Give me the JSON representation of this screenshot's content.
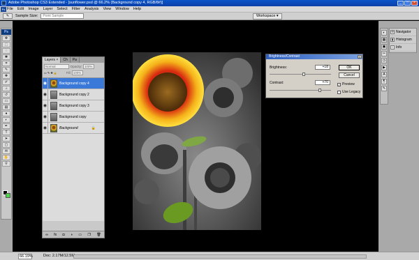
{
  "window": {
    "title": "Adobe Photoshop CS3 Extended - [sunflower.psd @ 66.2% (Background copy 4, RGB/8#)]",
    "buttons": [
      "_",
      "□",
      "×"
    ]
  },
  "menubar": {
    "items": [
      "File",
      "Edit",
      "Image",
      "Layer",
      "Select",
      "Filter",
      "Analysis",
      "View",
      "Window",
      "Help"
    ]
  },
  "options": {
    "sample_size_label": "Sample Size:",
    "sample_size_value": "Point Sample",
    "workspace_label": "Workspace ▾"
  },
  "layers_panel": {
    "tabs": [
      "Layers ×",
      "Ch",
      "Pa"
    ],
    "blend_mode": "Normal",
    "opacity_label": "Opacity:",
    "opacity": "100%",
    "fill_label": "Fill:",
    "fill": "100%",
    "layers": [
      {
        "name": "Background copy 4",
        "selected": true,
        "color": true
      },
      {
        "name": "Background copy 2",
        "selected": false,
        "color": false
      },
      {
        "name": "Background copy 3",
        "selected": false,
        "color": false
      },
      {
        "name": "Background copy",
        "selected": false,
        "color": false
      },
      {
        "name": "Background",
        "selected": false,
        "color": true,
        "italic": true
      }
    ]
  },
  "bc_dialog": {
    "title": "Brightness/Contrast",
    "brightness_label": "Brightness:",
    "brightness_value": "+18",
    "contrast_label": "Contrast:",
    "contrast_value": "+70",
    "ok_label": "OK",
    "cancel_label": "Cancel",
    "preview_label": "Preview",
    "preview_checked": true,
    "legacy_label": "Use Legacy",
    "legacy_checked": false
  },
  "right_panels": {
    "items": [
      "Navigator",
      "Histogram",
      "Info"
    ]
  },
  "status": {
    "zoom": "66.19%",
    "doc": "Doc: 2.17M/12.5M"
  },
  "colors": {
    "canvas": "#000000",
    "selection": "#3b79d8",
    "background_swatch": "#4fd64a"
  }
}
